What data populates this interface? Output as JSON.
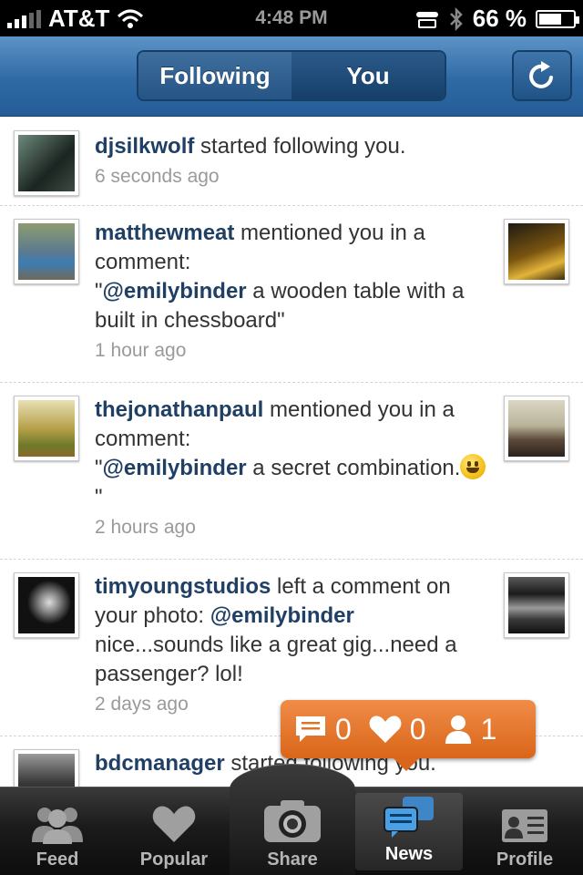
{
  "status_bar": {
    "carrier": "AT&T",
    "time": "4:48 PM",
    "battery": "66 %",
    "battery_level": 0.66
  },
  "header": {
    "tabs": [
      {
        "label": "Following",
        "active": false
      },
      {
        "label": "You",
        "active": true
      }
    ],
    "refresh_icon": "refresh-icon"
  },
  "feed": [
    {
      "user": "djsilkwolf",
      "action": " started following you.",
      "time": "6 seconds ago",
      "avatar_color": "#2f3b34"
    },
    {
      "user": "matthewmeat",
      "action": " mentioned you in a comment:",
      "quote_open": "\"",
      "mention": "@emilybinder",
      "quote_text": " a wooden table with a built in chessboard\"",
      "time": "1 hour ago",
      "avatar_color": "#6a7d5a",
      "thumb_color": "#a06a12"
    },
    {
      "user": "thejonathanpaul",
      "action": " mentioned you in a comment:",
      "quote_open": "\"",
      "mention": "@emilybinder",
      "quote_text": " a secret combination.",
      "quote_close": " \"",
      "time": "2 hours ago",
      "avatar_color": "#8c8a35",
      "thumb_color": "#a9a48c"
    },
    {
      "user": "timyoungstudios",
      "action": " left a comment on your photo: ",
      "mention": "@emilybinder",
      "quote_text": " nice...sounds like a great gig...need a passenger? lol!",
      "time": "2 days ago",
      "avatar_color": "#222222",
      "thumb_color": "#3b3b3b"
    },
    {
      "user": "bdcmanager",
      "action": " started following you.",
      "avatar_color": "#444444"
    }
  ],
  "notification_popup": {
    "comments": "0",
    "likes": "0",
    "followers": "1",
    "color": "#e8782f"
  },
  "tab_bar": {
    "items": [
      {
        "label": "Feed",
        "icon": "people-icon"
      },
      {
        "label": "Popular",
        "icon": "heart-icon"
      },
      {
        "label": "Share",
        "icon": "camera-icon"
      },
      {
        "label": "News",
        "icon": "chat-bubbles-icon",
        "active": true
      },
      {
        "label": "Profile",
        "icon": "id-card-icon"
      }
    ]
  }
}
